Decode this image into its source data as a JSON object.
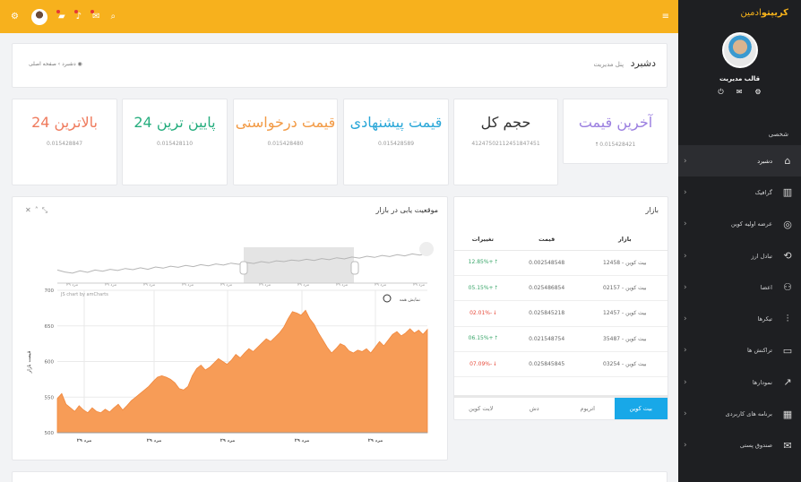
{
  "sidebar": {
    "brand_bold": "کریپتو",
    "brand_light": "ادمین",
    "profile_name": "قالب مدیریت",
    "section_label": "شخصی",
    "items": [
      {
        "label": "دشبرد",
        "icon": "home-icon",
        "active": true
      },
      {
        "label": "گرافیک",
        "icon": "bar-chart-icon",
        "active": false
      },
      {
        "label": "عرضه اولیه کوین",
        "icon": "compass-icon",
        "active": false
      },
      {
        "label": "تبادل ارز",
        "icon": "exchange-icon",
        "active": false
      },
      {
        "label": "اعضا",
        "icon": "users-icon",
        "active": false
      },
      {
        "label": "تیکرها",
        "icon": "sliders-icon",
        "active": false
      },
      {
        "label": "تراکنش ها",
        "icon": "folder-icon",
        "active": false
      },
      {
        "label": "نمودارها",
        "icon": "trend-icon",
        "active": false
      },
      {
        "label": "برنامه های کاربردی",
        "icon": "grid-icon",
        "active": false
      },
      {
        "label": "صندوق پستی",
        "icon": "mail-icon",
        "active": false
      }
    ]
  },
  "breadcrumb": {
    "title": "دشبرد",
    "subtitle": "پنل مدیریت",
    "home": "صفحه اصلی",
    "current": "دشبرد"
  },
  "stats": [
    {
      "label": "آخرین قیمت",
      "value": "0.015428421",
      "color": "#9b7fe0",
      "arrow": true
    },
    {
      "label": "حجم کل",
      "value": "41247502112451847451",
      "color": "#333333",
      "arrow": false
    },
    {
      "label": "قیمت پیشنهادی",
      "value": "0.015428589",
      "color": "#2aa7d8",
      "arrow": false
    },
    {
      "label": "قیمت درخواستی",
      "value": "0.015428480",
      "color": "#f29a45",
      "arrow": false
    },
    {
      "label": "پایین ترین 24",
      "value": "0.015428110",
      "color": "#27ae7f",
      "arrow": false
    },
    {
      "label": "بالاترین 24",
      "value": "0.015428847",
      "color": "#ef7a5c",
      "arrow": false
    }
  ],
  "market": {
    "title": "بازار",
    "headers": [
      "بازار",
      "قیمت",
      "تغییرات"
    ],
    "rows": [
      {
        "market": "بیت کوین - 12458",
        "price": "0.002548548",
        "change": "+12.85%",
        "dir": "up"
      },
      {
        "market": "بیت کوین - 02157",
        "price": "0.025486854",
        "change": "+05.15%",
        "dir": "up"
      },
      {
        "market": "بیت کوین - 12457",
        "price": "0.025845218",
        "change": "-02.01%",
        "dir": "dn"
      },
      {
        "market": "بیت کوین - 35487",
        "price": "0.021548754",
        "change": "+06.15%",
        "dir": "up"
      },
      {
        "market": "بیت کوین - 03254",
        "price": "0.025845845",
        "change": "-07.09%",
        "dir": "dn"
      }
    ],
    "tabs": [
      "بیت کوین",
      "اتریوم",
      "دش",
      "لایت کوین"
    ]
  },
  "chart_card": {
    "title": "موقعیت یابی در بازار",
    "credit": "JS chart by amCharts",
    "zoom_label": "نمایش همه"
  },
  "chart_data": {
    "type": "area",
    "ylabel": "قیمت بازار",
    "ylim": [
      500,
      700
    ],
    "yticks": [
      "700",
      "650",
      "600",
      "550",
      "500"
    ],
    "xticks": [
      "مرد ۲۹",
      "مرد ۲۹",
      "مرد ۲۹",
      "مرد ۲۹",
      "مرد ۲۹"
    ],
    "values": [
      548,
      555,
      540,
      535,
      530,
      538,
      532,
      528,
      535,
      530,
      528,
      533,
      529,
      535,
      540,
      532,
      538,
      545,
      550,
      555,
      560,
      565,
      572,
      578,
      580,
      578,
      575,
      570,
      562,
      560,
      565,
      580,
      590,
      595,
      588,
      592,
      598,
      604,
      600,
      596,
      602,
      610,
      605,
      612,
      618,
      614,
      620,
      626,
      632,
      628,
      634,
      640,
      648,
      660,
      670,
      668,
      665,
      672,
      660,
      652,
      640,
      630,
      620,
      612,
      618,
      625,
      622,
      615,
      612,
      616,
      614,
      618,
      612,
      620,
      628,
      622,
      630,
      638,
      642,
      636,
      640,
      646,
      640,
      644,
      638,
      645
    ],
    "overview_values": [
      620,
      615,
      612,
      618,
      614,
      620,
      617,
      622,
      619,
      624,
      621,
      626,
      622,
      628,
      625,
      630,
      627,
      632,
      629,
      634,
      631,
      636,
      633,
      638,
      635,
      640,
      637,
      642,
      639,
      644,
      642,
      646,
      644,
      648,
      645,
      650,
      647,
      652,
      649,
      654,
      651,
      656,
      653,
      658,
      655,
      660,
      657,
      662,
      659,
      664
    ],
    "fill_color": "#f79c57"
  }
}
